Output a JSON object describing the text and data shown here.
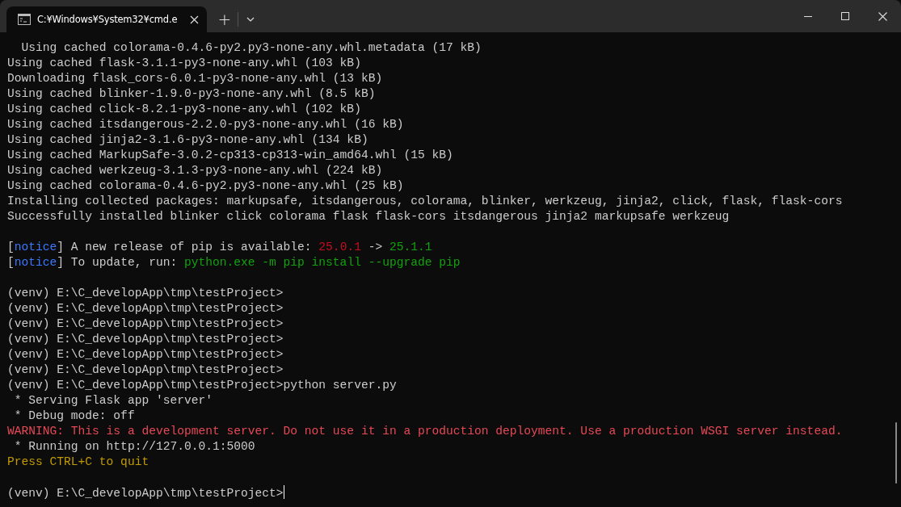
{
  "window": {
    "tab_title": "C:¥Windows¥System32¥cmd.e",
    "new_tab": "+"
  },
  "terminal": {
    "lines": [
      {
        "kind": "text",
        "segments": [
          {
            "text": "  Using cached colorama-0.4.6-py2.py3-none-any.whl.metadata (17 kB)",
            "color": "#cccccc"
          }
        ]
      },
      {
        "kind": "text",
        "segments": [
          {
            "text": "Using cached flask-3.1.1-py3-none-any.whl (103 kB)",
            "color": "#cccccc"
          }
        ]
      },
      {
        "kind": "text",
        "segments": [
          {
            "text": "Downloading flask_cors-6.0.1-py3-none-any.whl (13 kB)",
            "color": "#cccccc"
          }
        ]
      },
      {
        "kind": "text",
        "segments": [
          {
            "text": "Using cached blinker-1.9.0-py3-none-any.whl (8.5 kB)",
            "color": "#cccccc"
          }
        ]
      },
      {
        "kind": "text",
        "segments": [
          {
            "text": "Using cached click-8.2.1-py3-none-any.whl (102 kB)",
            "color": "#cccccc"
          }
        ]
      },
      {
        "kind": "text",
        "segments": [
          {
            "text": "Using cached itsdangerous-2.2.0-py3-none-any.whl (16 kB)",
            "color": "#cccccc"
          }
        ]
      },
      {
        "kind": "text",
        "segments": [
          {
            "text": "Using cached jinja2-3.1.6-py3-none-any.whl (134 kB)",
            "color": "#cccccc"
          }
        ]
      },
      {
        "kind": "text",
        "segments": [
          {
            "text": "Using cached MarkupSafe-3.0.2-cp313-cp313-win_amd64.whl (15 kB)",
            "color": "#cccccc"
          }
        ]
      },
      {
        "kind": "text",
        "segments": [
          {
            "text": "Using cached werkzeug-3.1.3-py3-none-any.whl (224 kB)",
            "color": "#cccccc"
          }
        ]
      },
      {
        "kind": "text",
        "segments": [
          {
            "text": "Using cached colorama-0.4.6-py2.py3-none-any.whl (25 kB)",
            "color": "#cccccc"
          }
        ]
      },
      {
        "kind": "text",
        "segments": [
          {
            "text": "Installing collected packages: markupsafe, itsdangerous, colorama, blinker, werkzeug, jinja2, click, flask, flask-cors",
            "color": "#cccccc"
          }
        ]
      },
      {
        "kind": "text",
        "segments": [
          {
            "text": "Successfully installed blinker click colorama flask flask-cors itsdangerous jinja2 markupsafe werkzeug",
            "color": "#cccccc"
          }
        ]
      },
      {
        "kind": "blank"
      },
      {
        "kind": "text",
        "segments": [
          {
            "text": "[",
            "color": "#cccccc"
          },
          {
            "text": "notice",
            "color": "#3b78ff"
          },
          {
            "text": "] A new release of pip is available: ",
            "color": "#cccccc"
          },
          {
            "text": "25.0.1",
            "color": "#c50f1f"
          },
          {
            "text": " -> ",
            "color": "#cccccc"
          },
          {
            "text": "25.1.1",
            "color": "#13a10e"
          }
        ]
      },
      {
        "kind": "text",
        "segments": [
          {
            "text": "[",
            "color": "#cccccc"
          },
          {
            "text": "notice",
            "color": "#3b78ff"
          },
          {
            "text": "] To update, run: ",
            "color": "#cccccc"
          },
          {
            "text": "python.exe -m pip install --upgrade pip",
            "color": "#13a10e"
          }
        ]
      },
      {
        "kind": "blank"
      },
      {
        "kind": "text",
        "segments": [
          {
            "text": "(venv) E:\\C_developApp\\tmp\\testProject>",
            "color": "#cccccc"
          }
        ]
      },
      {
        "kind": "text",
        "segments": [
          {
            "text": "(venv) E:\\C_developApp\\tmp\\testProject>",
            "color": "#cccccc"
          }
        ]
      },
      {
        "kind": "text",
        "segments": [
          {
            "text": "(venv) E:\\C_developApp\\tmp\\testProject>",
            "color": "#cccccc"
          }
        ]
      },
      {
        "kind": "text",
        "segments": [
          {
            "text": "(venv) E:\\C_developApp\\tmp\\testProject>",
            "color": "#cccccc"
          }
        ]
      },
      {
        "kind": "text",
        "segments": [
          {
            "text": "(venv) E:\\C_developApp\\tmp\\testProject>",
            "color": "#cccccc"
          }
        ]
      },
      {
        "kind": "text",
        "segments": [
          {
            "text": "(venv) E:\\C_developApp\\tmp\\testProject>",
            "color": "#cccccc"
          }
        ]
      },
      {
        "kind": "text",
        "segments": [
          {
            "text": "(venv) E:\\C_developApp\\tmp\\testProject>python server.py",
            "color": "#cccccc"
          }
        ]
      },
      {
        "kind": "text",
        "segments": [
          {
            "text": " * Serving Flask app 'server'",
            "color": "#cccccc"
          }
        ]
      },
      {
        "kind": "text",
        "segments": [
          {
            "text": " * Debug mode: off",
            "color": "#cccccc"
          }
        ]
      },
      {
        "kind": "text",
        "segments": [
          {
            "text": "WARNING: This is a development server. Do not use it in a production deployment. Use a production WSGI server instead.",
            "color": "#e74856"
          }
        ]
      },
      {
        "kind": "text",
        "segments": [
          {
            "text": " * Running on http://127.0.0.1:5000",
            "color": "#cccccc"
          }
        ]
      },
      {
        "kind": "text",
        "segments": [
          {
            "text": "Press CTRL+C to quit",
            "color": "#c19c00"
          }
        ]
      },
      {
        "kind": "blank"
      },
      {
        "kind": "text",
        "cursor": true,
        "segments": [
          {
            "text": "(venv) E:\\C_developApp\\tmp\\testProject>",
            "color": "#cccccc"
          }
        ]
      }
    ]
  }
}
